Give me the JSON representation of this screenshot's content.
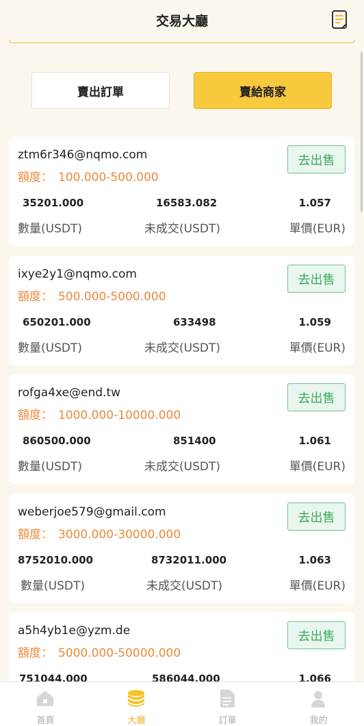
{
  "header": {
    "title": "交易大廳",
    "icon": "document-icon"
  },
  "switch": {
    "sell_label": "賣出訂單",
    "buy_label": "賣給商家"
  },
  "card_labels": {
    "quota": "額度：",
    "action": "去出售",
    "qty": "數量(USDT)",
    "unfilled": "未成交(USDT)",
    "price": "單價(EUR)"
  },
  "cards": [
    {
      "email": "ztm6r346@nqmo.com",
      "range": "100.000-500.000",
      "qty": "35201.000",
      "unfilled": "16583.082",
      "price": "1.057"
    },
    {
      "email": "ixye2y1@nqmo.com",
      "range": "500.000-5000.000",
      "qty": "650201.000",
      "unfilled": "633498",
      "price": "1.059"
    },
    {
      "email": "rofga4xe@end.tw",
      "range": "1000.000-10000.000",
      "qty": "860500.000",
      "unfilled": "851400",
      "price": "1.061"
    },
    {
      "email": "weberjoe579@gmail.com",
      "range": "3000.000-30000.000",
      "qty": "8752010.000",
      "unfilled": "8732011.000",
      "price": "1.063"
    },
    {
      "email": "a5h4yb1e@yzm.de",
      "range": "5000.000-50000.000",
      "qty": "751044.000",
      "unfilled": "586044.000",
      "price": "1.066"
    }
  ],
  "tabbar": {
    "home": "首頁",
    "hall": "大廳",
    "orders": "訂單",
    "mine": "我的"
  },
  "colors": {
    "accent": "#f8c83d",
    "quota": "#e98a3a",
    "go_green": "#3daa5c",
    "background": "#fbf7ec"
  }
}
